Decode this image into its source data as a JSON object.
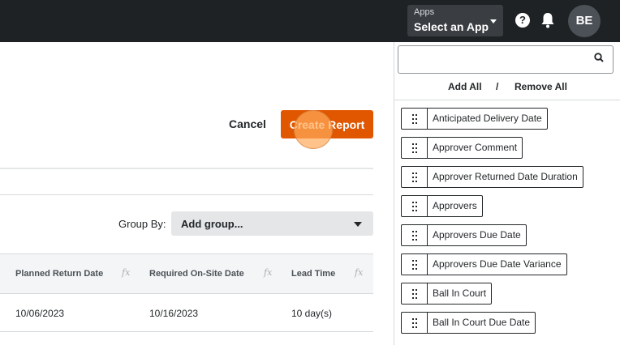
{
  "topbar": {
    "apps_label": "Apps",
    "apps_value": "Select an App",
    "help_glyph": "?",
    "avatar_initials": "BE"
  },
  "actions": {
    "cancel_label": "Cancel",
    "create_label": "Create Report"
  },
  "group_by": {
    "label": "Group By:",
    "value": "Add group..."
  },
  "table": {
    "columns": [
      {
        "label": "Planned Return Date",
        "fx": "fx"
      },
      {
        "label": "Required On-Site Date",
        "fx": "fx"
      },
      {
        "label": "Lead Time",
        "fx": "fx"
      }
    ],
    "rows": [
      [
        "10/06/2023",
        "10/16/2023",
        "10 day(s)"
      ]
    ]
  },
  "panel": {
    "search_placeholder": "",
    "add_all": "Add All",
    "separator": "/",
    "remove_all": "Remove All",
    "fields": [
      "Anticipated Delivery Date",
      "Approver Comment",
      "Approver Returned Date Duration",
      "Approvers",
      "Approvers Due Date",
      "Approvers Due Date Variance",
      "Ball In Court",
      "Ball In Court Due Date"
    ]
  },
  "colors": {
    "topbar": "#1f2225",
    "accent": "#e15700"
  }
}
